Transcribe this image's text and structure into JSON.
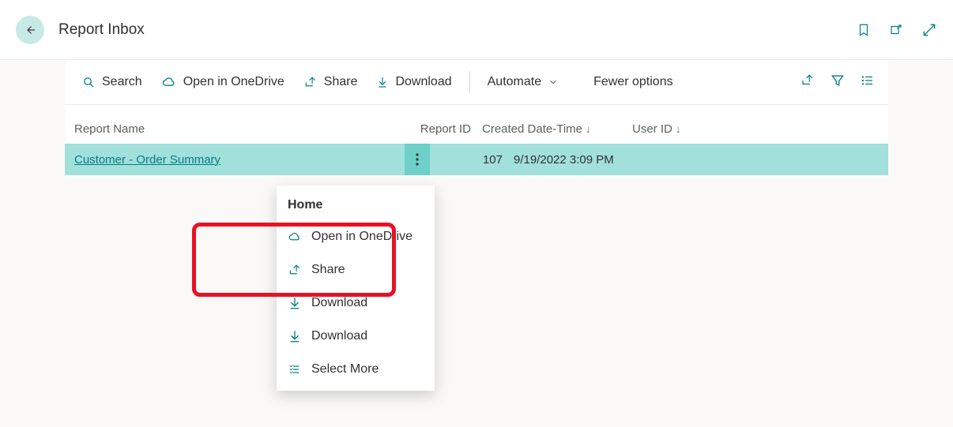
{
  "header": {
    "title": "Report Inbox"
  },
  "toolbar": {
    "search_label": "Search",
    "onedrive_label": "Open in OneDrive",
    "share_label": "Share",
    "download_label": "Download",
    "automate_label": "Automate",
    "fewer_label": "Fewer options"
  },
  "columns": {
    "name": "Report Name",
    "id": "Report ID",
    "date": "Created Date-Time",
    "user": "User ID"
  },
  "row": {
    "name": "Customer - Order Summary",
    "id": "107",
    "date": "9/19/2022 3:09 PM",
    "user": ""
  },
  "menu": {
    "title": "Home",
    "onedrive": "Open in OneDrive",
    "share": "Share",
    "download1": "Download",
    "download2": "Download",
    "select_more": "Select More"
  }
}
